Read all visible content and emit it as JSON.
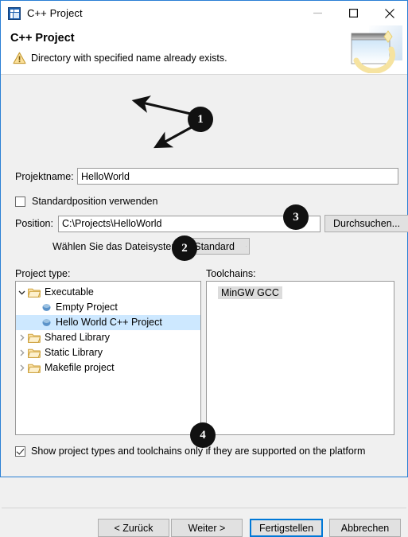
{
  "window": {
    "title": "C++ Project",
    "icon": "cpp-project-icon",
    "controls": {
      "minimize": "minimize-icon",
      "maximize": "maximize-icon",
      "close": "close-icon"
    }
  },
  "header": {
    "title": "C++ Project",
    "message": "Directory with specified name already exists.",
    "status_icon": "warning-icon",
    "banner_icon": "new-project-banner-icon"
  },
  "form": {
    "project_name_label": "Projektname:",
    "project_name_value": "HelloWorld",
    "default_location_label": "Standardposition verwenden",
    "default_location_checked": false,
    "location_label": "Position:",
    "location_value": "C:\\Projects\\HelloWorld",
    "browse_label": "Durchsuchen...",
    "filesystem_label": "Wählen Sie das Dateisystem:",
    "filesystem_value": "Standard"
  },
  "project_type": {
    "group_label": "Project type:",
    "nodes": [
      {
        "label": "Executable",
        "level": 1,
        "icon": "folder-open-icon",
        "expanded": true,
        "twisty": "chevron-down-icon",
        "selected": false
      },
      {
        "label": "Empty Project",
        "level": 2,
        "icon": "sphere-bullet-icon",
        "expanded": null,
        "twisty": "",
        "selected": false
      },
      {
        "label": "Hello World C++ Project",
        "level": 2,
        "icon": "sphere-bullet-icon",
        "expanded": null,
        "twisty": "",
        "selected": true
      },
      {
        "label": "Shared Library",
        "level": 1,
        "icon": "folder-open-icon",
        "expanded": false,
        "twisty": "chevron-right-icon",
        "selected": false
      },
      {
        "label": "Static Library",
        "level": 1,
        "icon": "folder-open-icon",
        "expanded": false,
        "twisty": "chevron-right-icon",
        "selected": false
      },
      {
        "label": "Makefile project",
        "level": 1,
        "icon": "folder-open-icon",
        "expanded": false,
        "twisty": "chevron-right-icon",
        "selected": false
      }
    ]
  },
  "toolchains": {
    "group_label": "Toolchains:",
    "items": [
      {
        "label": "MinGW GCC",
        "selected": true
      }
    ]
  },
  "footer": {
    "filter_label": "Show project types and toolchains only if they are supported on the platform",
    "filter_checked": true,
    "buttons": {
      "back": "< Zurück",
      "next": "Weiter >",
      "finish": "Fertigstellen",
      "cancel": "Abbrechen"
    },
    "focused_button": "Fertigstellen"
  },
  "annotations": [
    {
      "number": "1"
    },
    {
      "number": "2"
    },
    {
      "number": "3"
    },
    {
      "number": "4"
    }
  ],
  "colors": {
    "dialog_border": "#2a7fd4",
    "dialog_background": "#f0f0f0",
    "selection_blue": "#cde8ff",
    "selection_gray": "#dcdcdc",
    "focus_blue": "#0078d7",
    "warning_amber": "#f2c34a",
    "annotation_black": "#111111"
  }
}
